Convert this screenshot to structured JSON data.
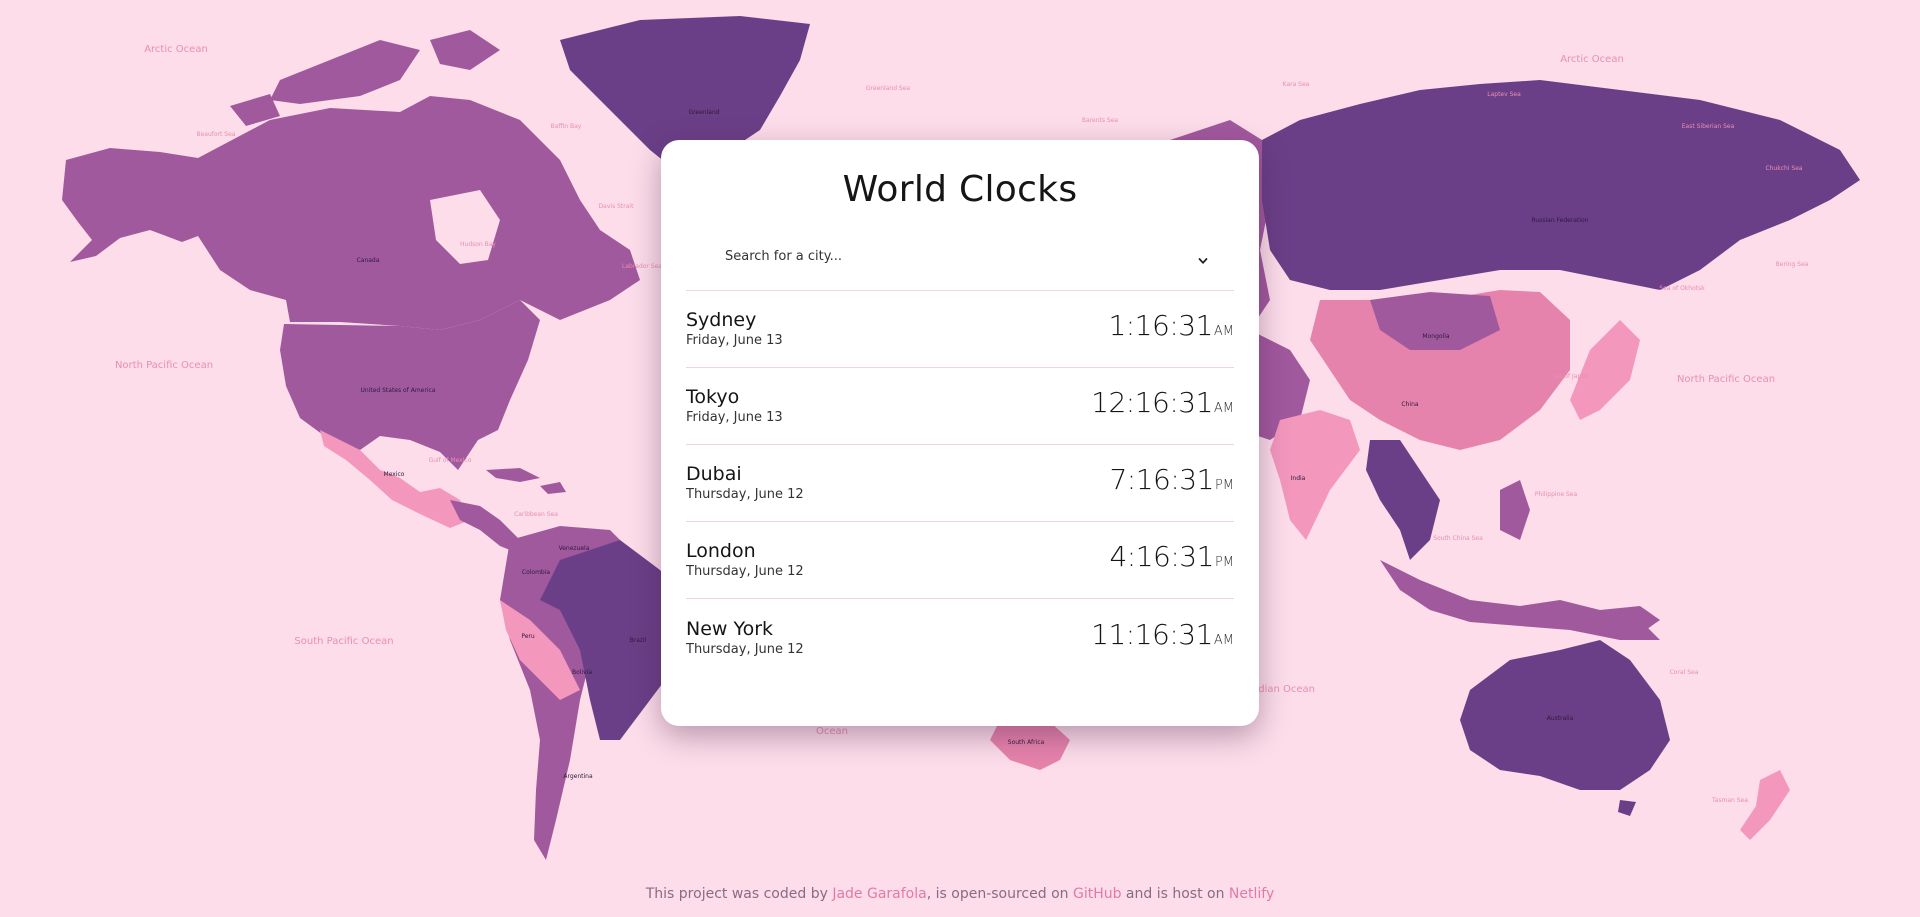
{
  "colors": {
    "background": "#fcdde9",
    "land_dark": "#6b3f87",
    "land_mid": "#a1599e",
    "land_pink": "#e583ac",
    "land_light": "#f397bd",
    "card": "#ffffff",
    "link": "#e27aa6"
  },
  "map": {
    "oceans": [
      "Arctic Ocean",
      "Arctic Ocean",
      "North Pacific Ocean",
      "North Pacific Ocean",
      "South Pacific Ocean",
      "Indian Ocean",
      "Ocean"
    ],
    "seas": [
      "Beaufort Sea",
      "Baffin Bay",
      "Hudson Bay",
      "Davis Strait",
      "Labrador Sea",
      "Gulf of Mexico",
      "Caribbean Sea",
      "Barents Sea",
      "Kara Sea",
      "Laptev Sea",
      "East Siberian Sea",
      "Greenland Sea",
      "Chukchi Sea",
      "Bering Sea",
      "Sea of Okhotsk",
      "Sea of Japan",
      "Philippine Sea",
      "South China Sea",
      "Coral Sea",
      "Tasman Sea"
    ],
    "countries": [
      "Canada",
      "United States of America",
      "Mexico",
      "Greenland",
      "Russian Federation",
      "China",
      "Mongolia",
      "India",
      "Brazil",
      "Bolivia",
      "Argentina",
      "Peru",
      "Colombia",
      "Venezuela",
      "Australia",
      "South Africa"
    ]
  },
  "card": {
    "title": "World Clocks",
    "select": {
      "placeholder": "Search for a city...",
      "icon": "chevron-down-icon"
    },
    "cities": [
      {
        "name": "Sydney",
        "date": "Friday, June 13",
        "time": "1:16:31",
        "ampm": "AM"
      },
      {
        "name": "Tokyo",
        "date": "Friday, June 13",
        "time": "12:16:31",
        "ampm": "AM"
      },
      {
        "name": "Dubai",
        "date": "Thursday, June 12",
        "time": "7:16:31",
        "ampm": "PM"
      },
      {
        "name": "London",
        "date": "Thursday, June 12",
        "time": "4:16:31",
        "ampm": "PM"
      },
      {
        "name": "New York",
        "date": "Thursday, June 12",
        "time": "11:16:31",
        "ampm": "AM"
      }
    ]
  },
  "footer": {
    "text_1": "This project was coded by ",
    "author_link": "Jade Garafola",
    "text_2": ", is open-sourced on ",
    "github_link": "GitHub",
    "text_3": " and is host on ",
    "netlify_link": "Netlify"
  }
}
